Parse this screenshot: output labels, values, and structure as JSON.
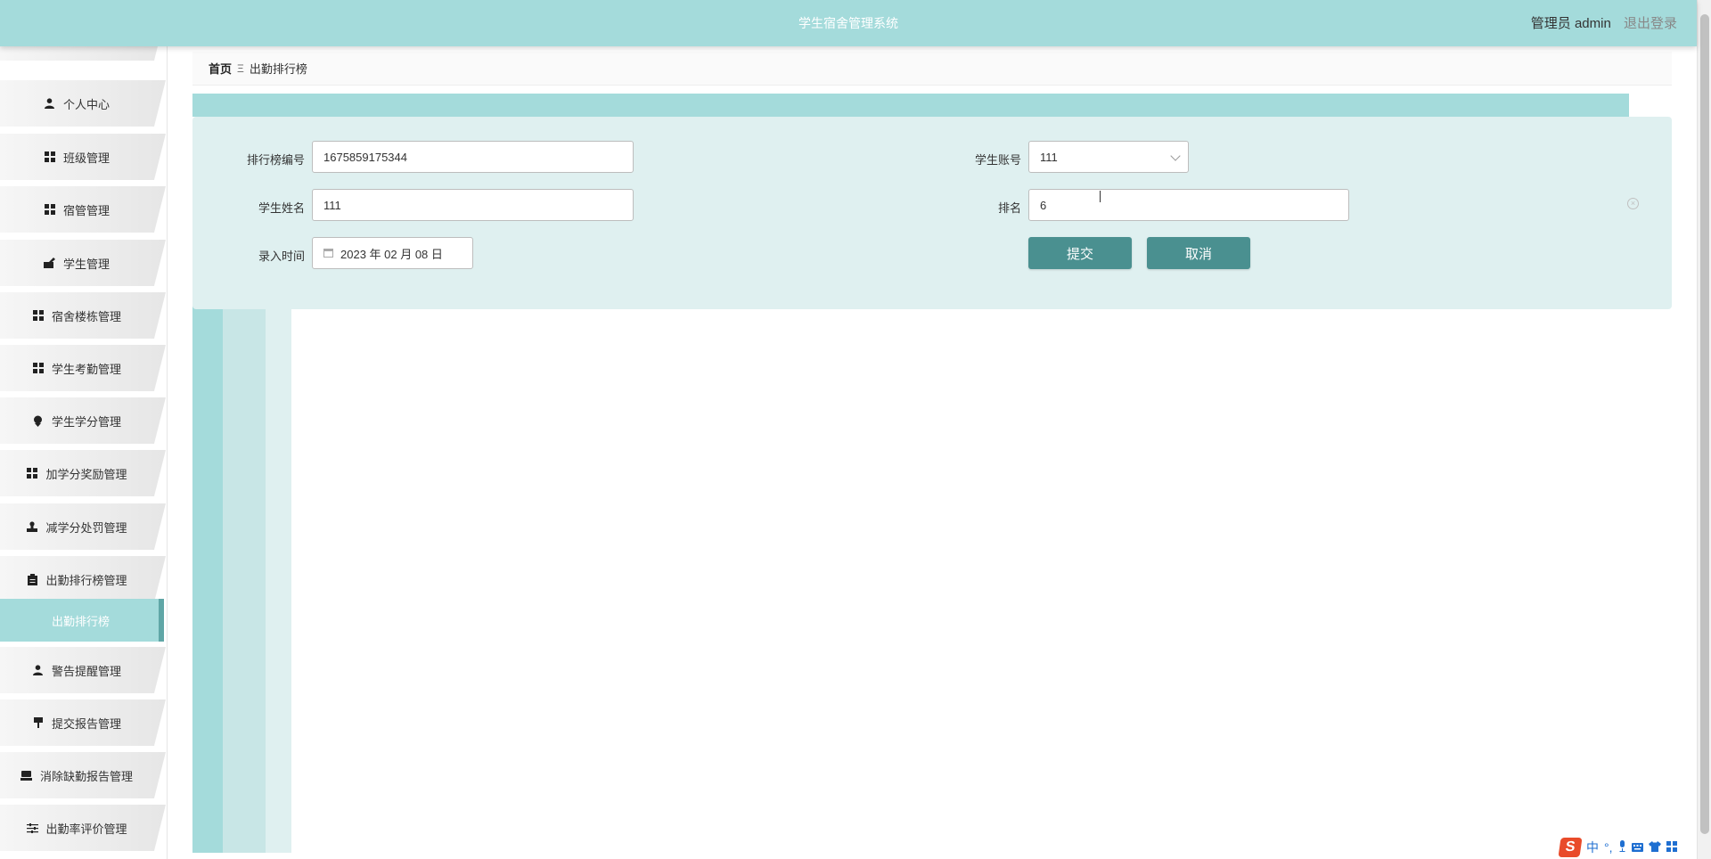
{
  "header": {
    "app_title": "学生宿舍管理系统",
    "user_label": "管理员 admin",
    "logout_label": "退出登录"
  },
  "sidebar": {
    "items": [
      {
        "label": "个人中心",
        "icon": "user-icon"
      },
      {
        "label": "班级管理",
        "icon": "grid-icon"
      },
      {
        "label": "宿管管理",
        "icon": "grid-icon"
      },
      {
        "label": "学生管理",
        "icon": "pen-icon"
      },
      {
        "label": "宿舍楼栋管理",
        "icon": "grid-icon"
      },
      {
        "label": "学生考勤管理",
        "icon": "grid-icon"
      },
      {
        "label": "学生学分管理",
        "icon": "pin-icon"
      },
      {
        "label": "加学分奖励管理",
        "icon": "grid-icon"
      },
      {
        "label": "减学分处罚管理",
        "icon": "stamp-icon"
      },
      {
        "label": "出勤排行榜管理",
        "icon": "clipboard-icon"
      },
      {
        "label": "出勤排行榜",
        "icon": "",
        "active_sub": true
      },
      {
        "label": "警告提醒管理",
        "icon": "user-icon"
      },
      {
        "label": "提交报告管理",
        "icon": "flag-icon"
      },
      {
        "label": "消除缺勤报告管理",
        "icon": "laptop-icon"
      },
      {
        "label": "出勤率评价管理",
        "icon": "sliders-icon"
      }
    ]
  },
  "breadcrumb": {
    "home": "首页",
    "separator": "Ξ",
    "current": "出勤排行榜"
  },
  "form": {
    "ranking_no": {
      "label": "排行榜编号",
      "value": "1675859175344"
    },
    "student_account": {
      "label": "学生账号",
      "value": "111"
    },
    "student_name": {
      "label": "学生姓名",
      "value": "111"
    },
    "rank": {
      "label": "排名",
      "value": "6"
    },
    "entry_time": {
      "label": "录入时间",
      "value": "2023 年 02 月 08 日"
    },
    "submit_label": "提交",
    "cancel_label": "取消"
  },
  "ime": {
    "lang": "中",
    "punct": "°,"
  },
  "colors": {
    "header_bg": "#a4dbdb",
    "panel_bg": "#dff0f0",
    "button_bg": "#4a9090"
  }
}
